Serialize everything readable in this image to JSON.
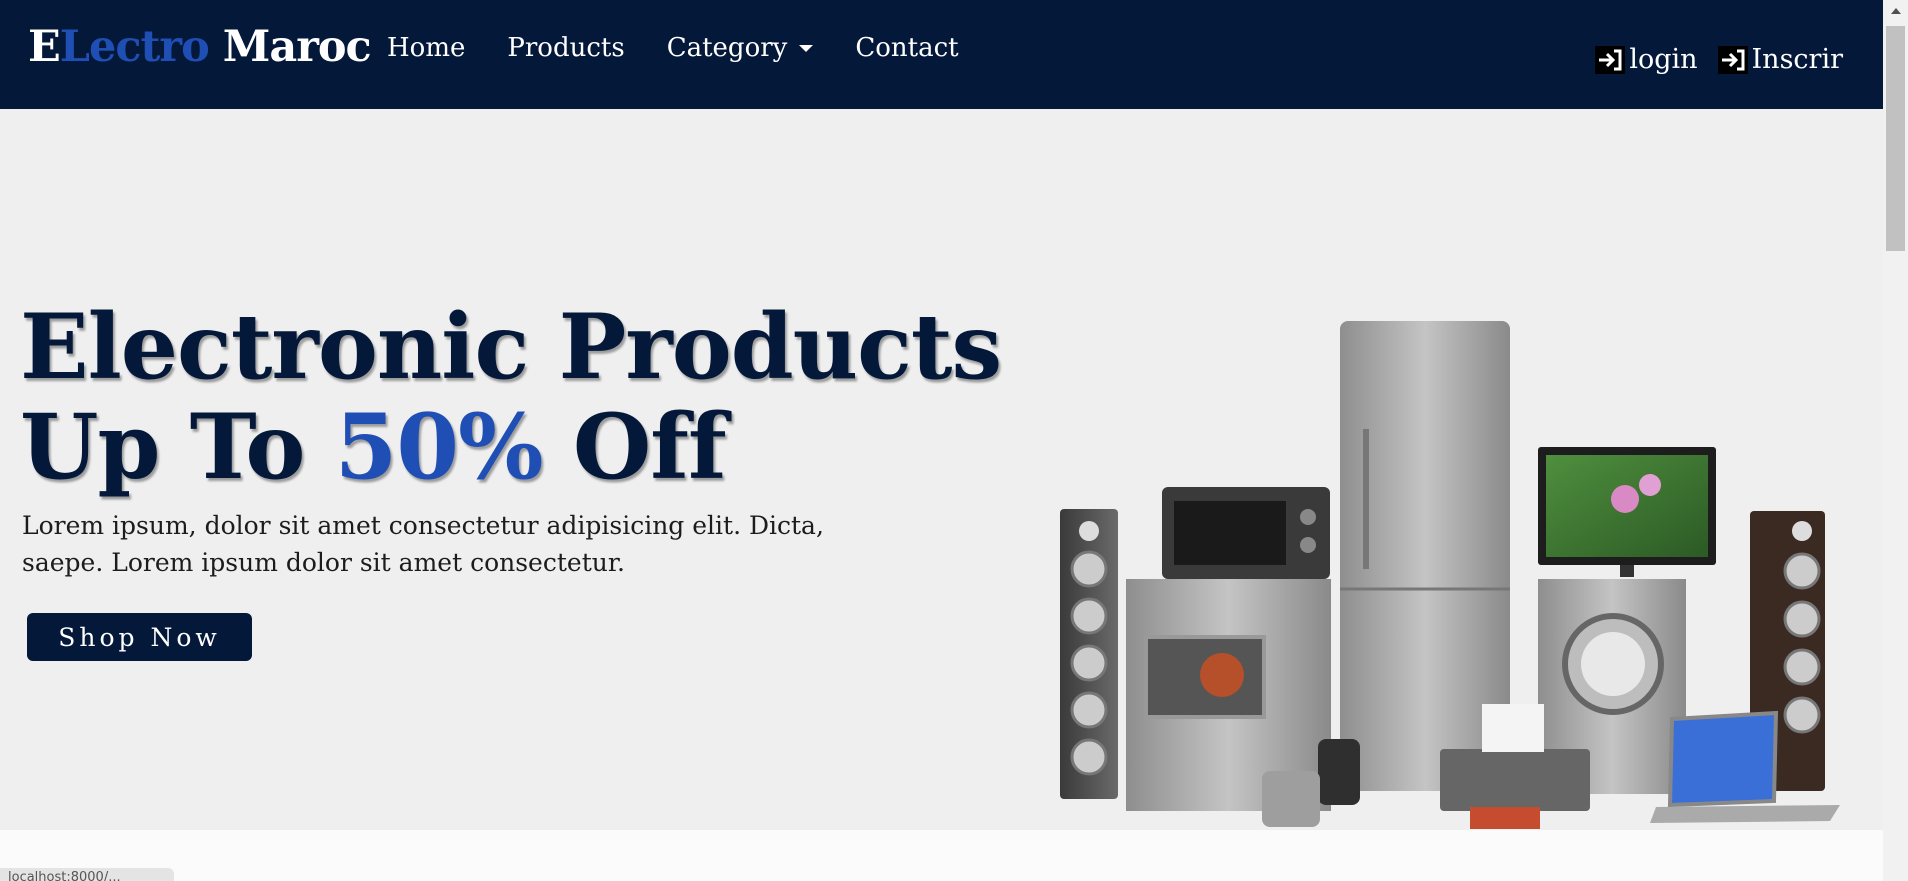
{
  "brand": {
    "part1": "E",
    "part2": "Lectro",
    "part3": " Maroc"
  },
  "nav": {
    "home": "Home",
    "products": "Products",
    "category": "Category",
    "contact": "Contact"
  },
  "auth": {
    "login": "login",
    "signup": "Inscrir"
  },
  "hero": {
    "title_line1": "Electronic Products",
    "title_line2_prefix": "Up To ",
    "title_line2_accent": "50%",
    "title_line2_suffix": " Off",
    "description": "Lorem ipsum, dolor sit amet consectetur adipisicing elit. Dicta, saepe. Lorem ipsum dolor sit amet consectetur.",
    "cta": "Shop Now"
  },
  "status": {
    "url_preview": "localhost:8000/..."
  },
  "colors": {
    "navbar": "#04183a",
    "accent": "#1f4fb4",
    "hero_bg": "#efefef"
  },
  "icons": {
    "login": "login-icon",
    "signup": "login-icon",
    "category": "chevron-down-icon"
  }
}
